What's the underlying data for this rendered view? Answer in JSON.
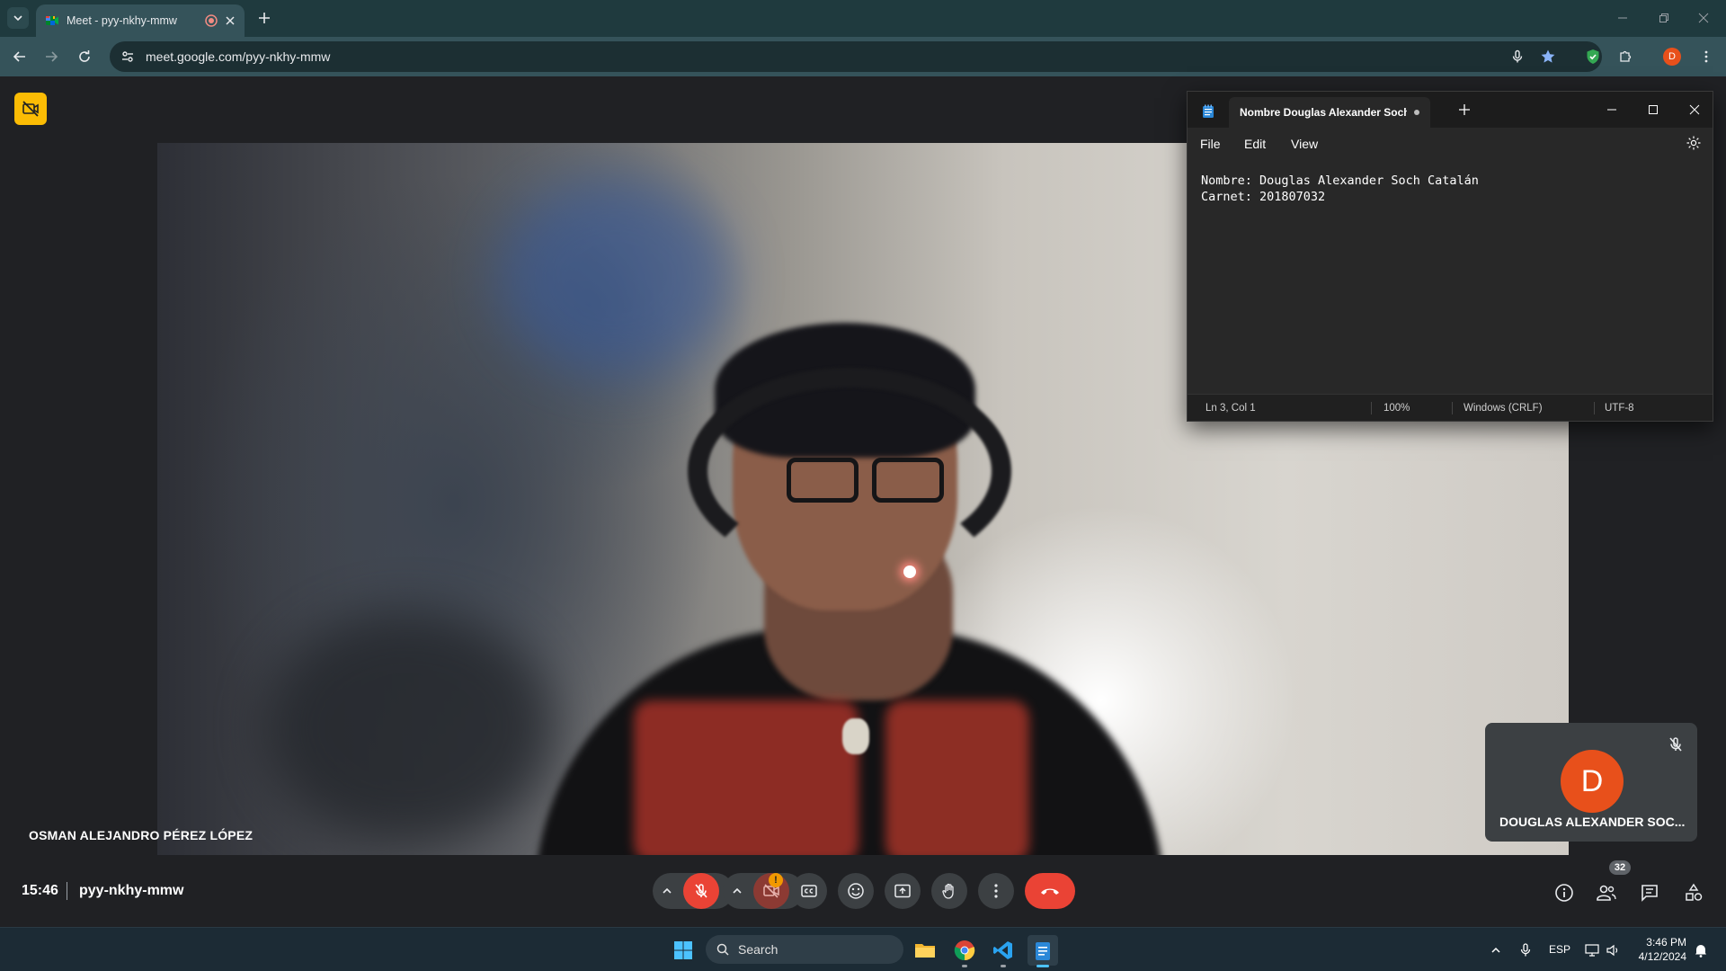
{
  "browser": {
    "tab_title": "Meet - pyy-nkhy-mmw",
    "url": "meet.google.com/pyy-nkhy-mmw",
    "profile_initial": "D"
  },
  "meet": {
    "main_participant": "OSMAN ALEJANDRO PÉREZ LÓPEZ",
    "self_participant": "DOUGLAS ALEXANDER SOC...",
    "self_initial": "D",
    "time": "15:46",
    "meeting_code": "pyy-nkhy-mmw",
    "people_count": "32",
    "camera_alert": "!",
    "colors": {
      "end_call": "#ea4335",
      "avatar": "#e8501b",
      "badge": "#fbbc04"
    }
  },
  "notepad": {
    "tab_title": "Nombre Douglas Alexander Soch C",
    "menu": [
      "File",
      "Edit",
      "View"
    ],
    "content": "Nombre: Douglas Alexander Soch Catalán\nCarnet: 201807032",
    "status": {
      "position": "Ln 3, Col 1",
      "zoom": "100%",
      "line_ending": "Windows (CRLF)",
      "encoding": "UTF-8"
    }
  },
  "taskbar": {
    "search_placeholder": "Search",
    "language": "ESP",
    "time": "3:46 PM",
    "date": "4/12/2024"
  }
}
